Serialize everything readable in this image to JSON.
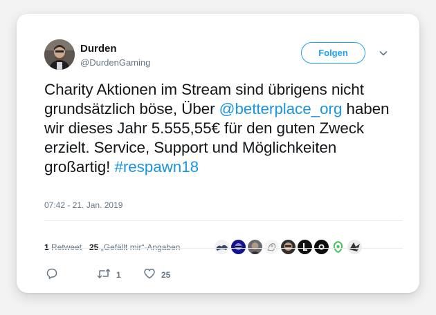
{
  "author": {
    "display_name": "Durden",
    "handle": "@DurdenGaming"
  },
  "follow_label": "Folgen",
  "tweet": {
    "part1": "Charity Aktionen im Stream sind übrigens nicht grundsätzlich böse, Über ",
    "mention": "@betterplace_org",
    "part2": " haben wir dieses Jahr 5.555,55€ für den guten Zweck erzielt. Service, Support und Möglichkeiten großartig! ",
    "hashtag": "#respawn18"
  },
  "timestamp": "07:42 - 21. Jan. 2019",
  "stats": {
    "retweets_count": "1",
    "retweets_label": "Retweet",
    "likes_count": "25",
    "likes_label": "„Gefällt mir“-Angaben"
  },
  "actions": {
    "retweet_count": "1",
    "like_count": "25"
  },
  "colors": {
    "accent": "#1da1f2",
    "link": "#1b95e0",
    "muted": "#657786",
    "text": "#14171a"
  },
  "icons": [
    "reply-icon",
    "retweet-icon",
    "heart-icon",
    "chevron-down-icon"
  ]
}
